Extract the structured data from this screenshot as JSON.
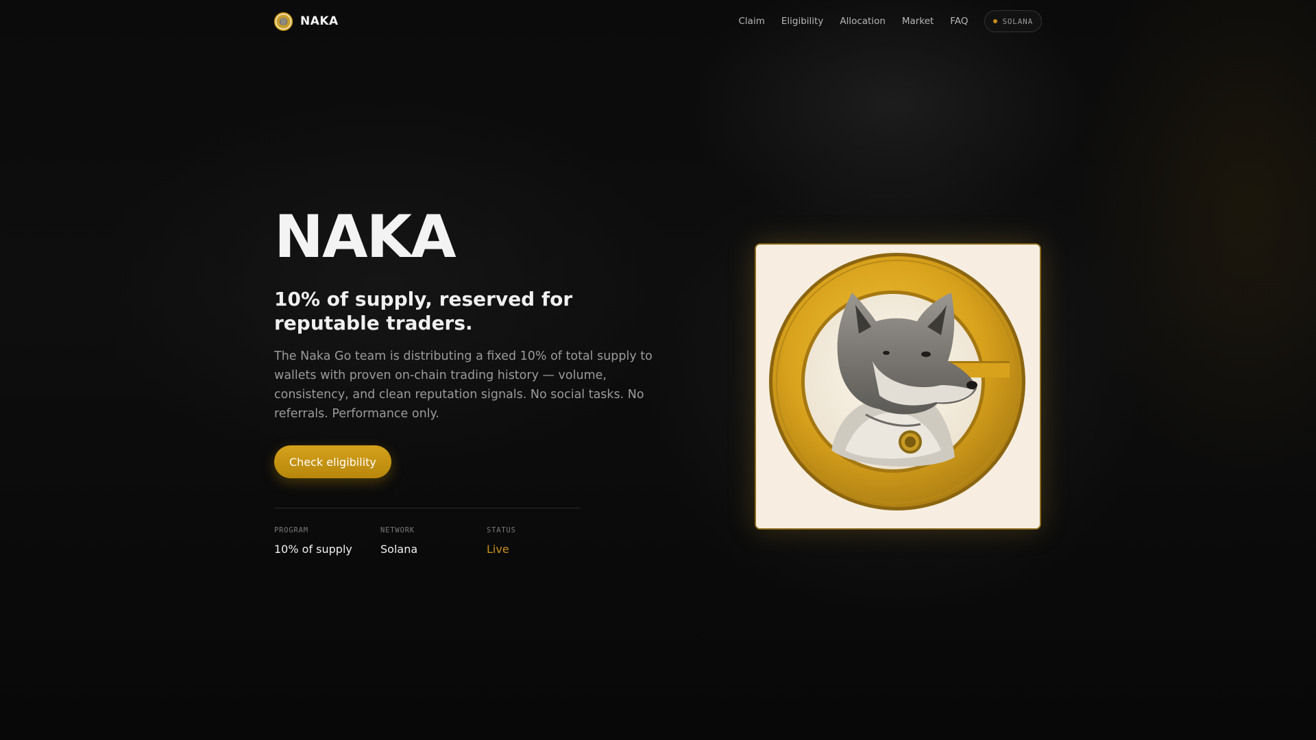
{
  "nav": {
    "brand": "NAKA",
    "links": [
      "Claim",
      "Eligibility",
      "Allocation",
      "Market",
      "FAQ"
    ],
    "network_pill": "SOLANA"
  },
  "hero": {
    "title": "NAKA",
    "subtitle": "10% of supply, reserved for reputable traders.",
    "description": "The Naka Go team is distributing a fixed 10% of total supply to wallets with proven on-chain trading history — volume, consistency, and clean reputation signals. No social tasks. No referrals. Performance only.",
    "cta_label": "Check eligibility"
  },
  "stats": [
    {
      "label": "PROGRAM",
      "value": "10% of supply"
    },
    {
      "label": "NETWORK",
      "value": "Solana"
    },
    {
      "label": "STATUS",
      "value": "Live"
    }
  ],
  "colors": {
    "accent": "#c8921e",
    "background": "#0a0a0a",
    "card_background": "#f7eee1"
  },
  "icons": {
    "brand_logo": "shiba-coin-logo-icon",
    "network_dot": "status-dot-icon",
    "hero_image": "shiba-inu-coin-illustration"
  }
}
